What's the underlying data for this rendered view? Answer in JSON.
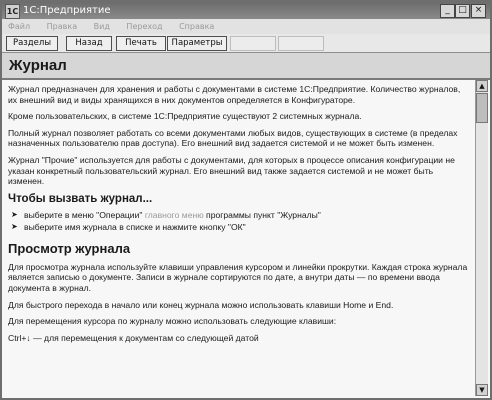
{
  "window": {
    "title": "1С:Предприятие",
    "minimize_glyph": "_",
    "maximize_glyph": "□",
    "close_glyph": "×"
  },
  "menubar": {
    "items": [
      "Файл",
      "Правка",
      "Вид",
      "Переход",
      "Справка"
    ]
  },
  "toolbar": {
    "sections_label": "Разделы",
    "back_label": "Назад",
    "print_label": "Печать",
    "parameters_label": "Параметры",
    "dim_labels": [
      "",
      ""
    ]
  },
  "page": {
    "heading": "Журнал",
    "p1": "Журнал предназначен для хранения и работы с документами в системе 1С:Предприятие. Количество журналов, их внешний вид и виды хранящихся в них документов определяется в Конфигураторе.",
    "p2": "Кроме пользовательских, в системе 1С:Предприятие существуют 2 системных журнала.",
    "p3": "Полный журнал позволяет работать со всеми документами любых видов, существующих в системе (в пределах назначенных пользователю прав доступа). Его внешний вид задается системой и не может быть изменен.",
    "p4": "Журнал \"Прочие\" используется для работы с документами, для которых в процессе описания конфигурации не указан конкретный пользовательский журнал. Его внешний вид также задается системой и не может быть изменен.",
    "h_call": "Чтобы вызвать журнал...",
    "bullet1_a": "выберите в меню \"Операции\" ",
    "bullet1_link": "главного меню",
    "bullet1_b": " программы пункт \"Журналы\"",
    "bullet2": "выберите имя журнала в списке и нажмите кнопку \"ОК\"",
    "h_view": "Просмотр журнала",
    "p5": "Для просмотра журнала используйте клавиши управления курсором и линейки прокрутки. Каждая строка журнала является записью о документе. Записи в журнале сортируются по дате, а внутри даты — по времени ввода документа в журнал.",
    "p6": "Для быстрого перехода в начало или конец журнала можно использовать клавиши Home и End.",
    "p7": "Для перемещения курсора по журналу можно использовать следующие клавиши:",
    "p8": "Ctrl+↓ — для перемещения к документам со следующей датой"
  }
}
